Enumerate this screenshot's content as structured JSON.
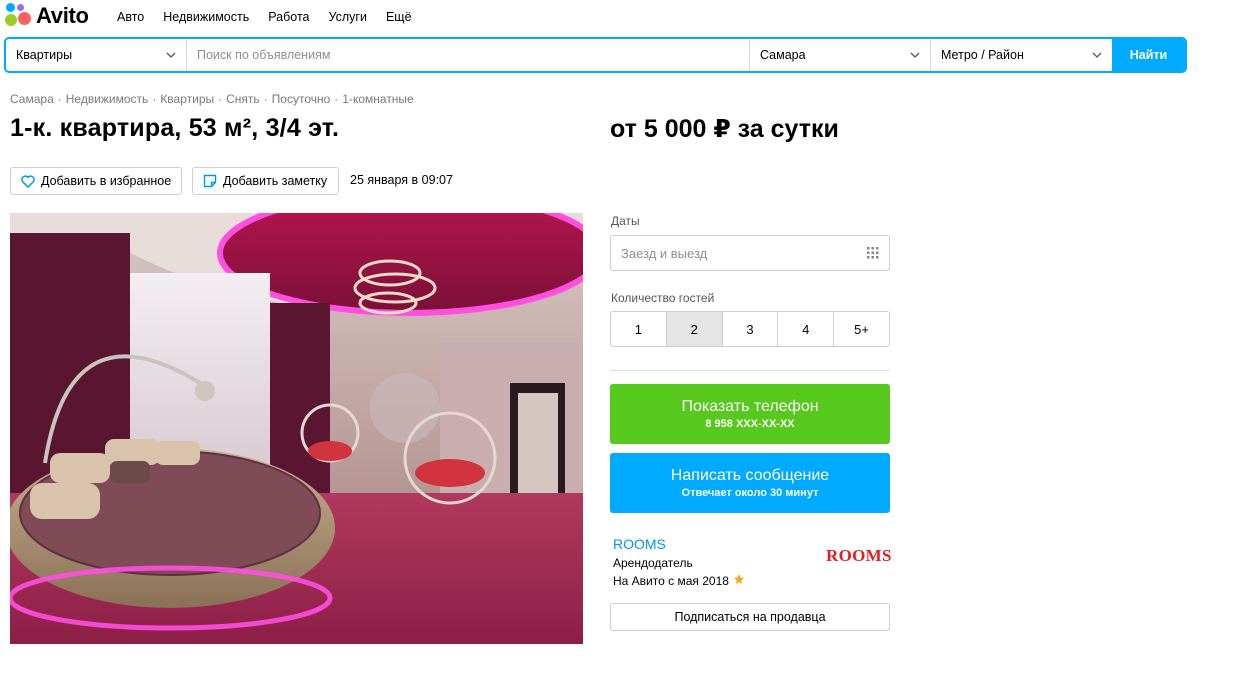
{
  "header": {
    "logo_text": "Avito",
    "nav": [
      "Авто",
      "Недвижимость",
      "Работа",
      "Услуги",
      "Ещё"
    ]
  },
  "search": {
    "category": "Квартиры",
    "query_placeholder": "Поиск по объявлениям",
    "city": "Самара",
    "metro": "Метро / Район",
    "submit_label": "Найти"
  },
  "breadcrumbs": [
    "Самара",
    "Недвижимость",
    "Квартиры",
    "Снять",
    "Посуточно",
    "1-комнатные"
  ],
  "listing": {
    "title": "1-к. квартира, 53 м², 3/4 эт.",
    "price": "от 5 000 ₽ за сутки",
    "favorite_label": "Добавить в избранное",
    "note_label": "Добавить заметку",
    "posted": "25 января в 09:07"
  },
  "booking": {
    "dates_label": "Даты",
    "dates_placeholder": "Заезд и выезд",
    "guests_label": "Количество гостей",
    "guests": [
      "1",
      "2",
      "3",
      "4",
      "5+"
    ],
    "selected_guests": "2"
  },
  "contact": {
    "phone_label": "Показать телефон",
    "phone_number": "8 958 XXX-XX-XX",
    "message_label": "Написать сообщение",
    "message_sub": "Отвечает около 30 минут"
  },
  "seller": {
    "name": "ROOMS",
    "role": "Арендодатель",
    "since": "На Авито с мая 2018",
    "logo_text": "ROOMS",
    "subscribe_label": "Подписаться на продавца"
  },
  "colors": {
    "accent_blue": "#00aaff",
    "phone_green": "#56c81e",
    "seller_link": "#0099e6",
    "rooms_red": "#e31d24"
  }
}
